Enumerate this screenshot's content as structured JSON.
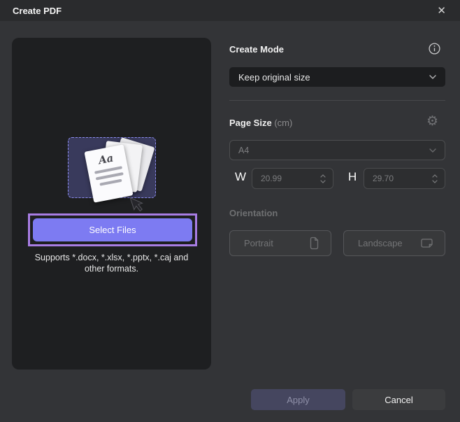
{
  "window": {
    "title": "Create PDF"
  },
  "icons": {
    "close": "✕",
    "gear": "⚙"
  },
  "left_panel": {
    "illustration_sample_text": "Aa",
    "select_files_label": "Select Files",
    "supports_line1": "Supports *.docx, *.xlsx, *.pptx, *.caj and",
    "supports_line2": "other formats."
  },
  "create_mode": {
    "label": "Create Mode",
    "selected": "Keep original size"
  },
  "page_size": {
    "label": "Page Size",
    "unit_suffix": "(cm)",
    "preset": "A4",
    "width_label": "W",
    "width_value": "20.99",
    "height_label": "H",
    "height_value": "29.70"
  },
  "orientation": {
    "label": "Orientation",
    "portrait_label": "Portrait",
    "landscape_label": "Landscape"
  },
  "footer": {
    "apply_label": "Apply",
    "cancel_label": "Cancel"
  },
  "colors": {
    "accent_button": "#7d7bf2",
    "highlight_outline": "#a87de4",
    "apply_disabled_bg": "#45465f",
    "dashed_box_bg": "#393a5c",
    "panel_bg": "#1e1f21",
    "dialog_bg": "#333437"
  }
}
